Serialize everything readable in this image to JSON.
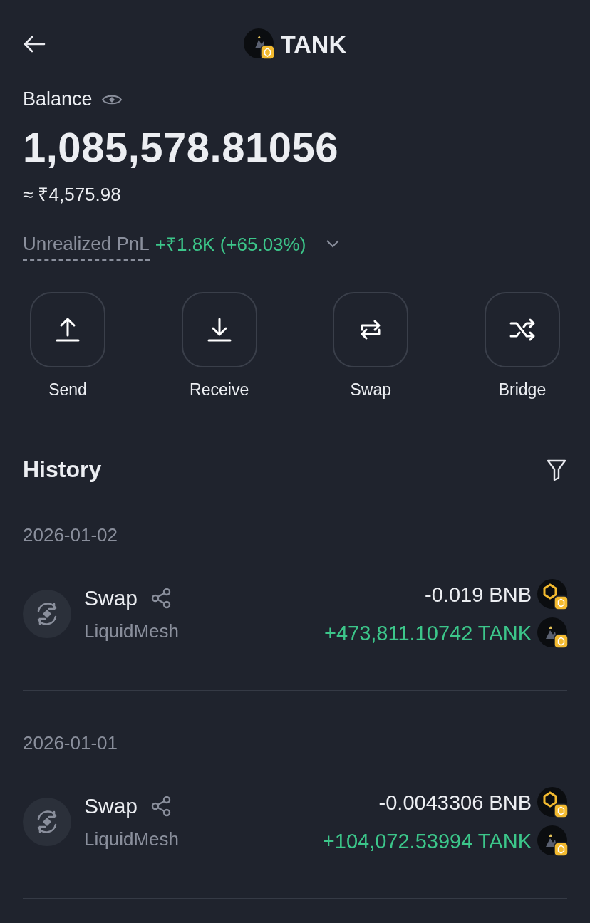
{
  "header": {
    "title": "TANK"
  },
  "balance": {
    "label": "Balance",
    "amount": "1,085,578.81056",
    "fiat": "≈ ₹4,575.98",
    "pnl_label": "Unrealized PnL",
    "pnl_value": "+₹1.8K (+65.03%)"
  },
  "actions": [
    {
      "kind": "send",
      "label": "Send"
    },
    {
      "kind": "receive",
      "label": "Receive"
    },
    {
      "kind": "swap",
      "label": "Swap"
    },
    {
      "kind": "bridge",
      "label": "Bridge"
    }
  ],
  "history": {
    "title": "History",
    "groups": [
      {
        "date": "2026-01-02",
        "items": [
          {
            "type": "Swap",
            "source": "LiquidMesh",
            "amounts": [
              {
                "kind": "bnb",
                "incoming": false,
                "text": "-0.019 BNB"
              },
              {
                "kind": "tank",
                "incoming": true,
                "text": "+473,811.10742 TANK"
              }
            ]
          }
        ]
      },
      {
        "date": "2026-01-01",
        "items": [
          {
            "type": "Swap",
            "source": "LiquidMesh",
            "amounts": [
              {
                "kind": "bnb",
                "incoming": false,
                "text": "-0.0043306 BNB"
              },
              {
                "kind": "tank",
                "incoming": true,
                "text": "+104,072.53994 TANK"
              }
            ]
          }
        ]
      }
    ]
  }
}
